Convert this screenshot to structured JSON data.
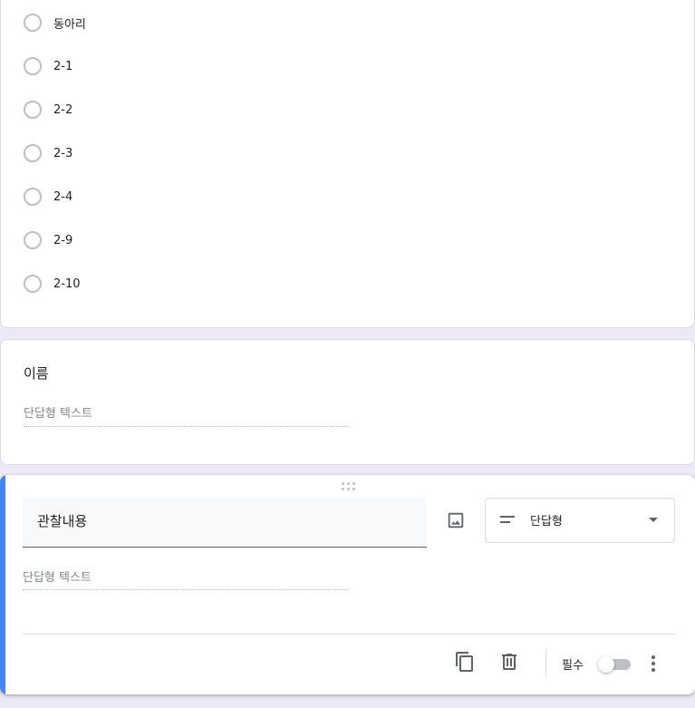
{
  "card_options": {
    "options": [
      "동아리",
      "2-1",
      "2-2",
      "2-3",
      "2-4",
      "2-9",
      "2-10"
    ]
  },
  "card_name": {
    "title": "이름",
    "hint": "단답형 텍스트"
  },
  "card_edit": {
    "title": "관찰내용",
    "hint": "단답형 텍스트",
    "type_label": "단답형",
    "required_label": "필수",
    "required_on": false,
    "accent_color": "#4285f4",
    "icons": {
      "drag": "drag-handle-icon",
      "image": "image-icon",
      "type": "short-text-icon",
      "dropdown": "dropdown-arrow-icon",
      "duplicate": "copy-icon",
      "delete": "trash-icon",
      "more": "more-vert-icon"
    }
  }
}
